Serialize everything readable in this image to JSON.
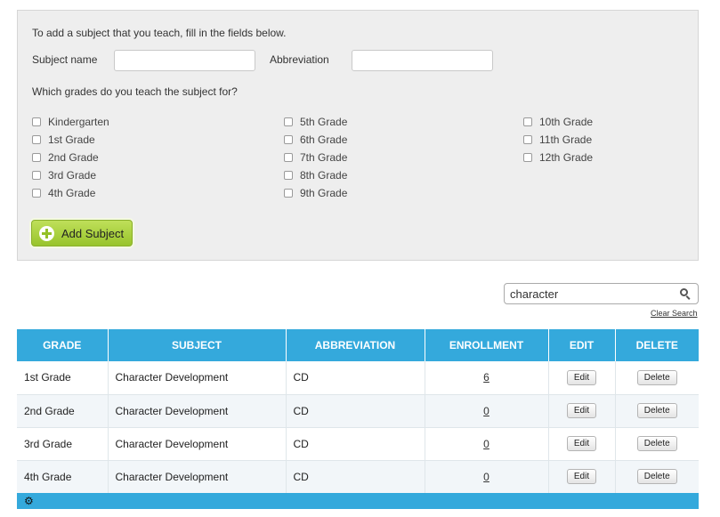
{
  "form": {
    "intro": "To add a subject that you teach, fill in the fields below.",
    "subject_name_label": "Subject name",
    "subject_name_value": "",
    "abbreviation_label": "Abbreviation",
    "abbreviation_value": "",
    "grades_question": "Which grades do you teach the subject for?",
    "grades": [
      "Kindergarten",
      "1st Grade",
      "2nd Grade",
      "3rd Grade",
      "4th Grade",
      "5th Grade",
      "6th Grade",
      "7th Grade",
      "8th Grade",
      "9th Grade",
      "10th Grade",
      "11th Grade",
      "12th Grade"
    ],
    "add_button_label": "Add Subject",
    "add_button_color": "#a6cd37"
  },
  "search": {
    "value": "character",
    "clear_label": "Clear Search"
  },
  "table": {
    "header_color": "#34a9dc",
    "columns": [
      "GRADE",
      "SUBJECT",
      "ABBREVIATION",
      "ENROLLMENT",
      "EDIT",
      "DELETE"
    ],
    "rows": [
      {
        "grade": "1st Grade",
        "subject": "Character Development",
        "abbreviation": "CD",
        "enrollment": "6",
        "edit": "Edit",
        "delete": "Delete"
      },
      {
        "grade": "2nd Grade",
        "subject": "Character Development",
        "abbreviation": "CD",
        "enrollment": "0",
        "edit": "Edit",
        "delete": "Delete"
      },
      {
        "grade": "3rd Grade",
        "subject": "Character Development",
        "abbreviation": "CD",
        "enrollment": "0",
        "edit": "Edit",
        "delete": "Delete"
      },
      {
        "grade": "4th Grade",
        "subject": "Character Development",
        "abbreviation": "CD",
        "enrollment": "0",
        "edit": "Edit",
        "delete": "Delete"
      }
    ]
  },
  "footer": {
    "settings_icon": "gear-icon"
  }
}
